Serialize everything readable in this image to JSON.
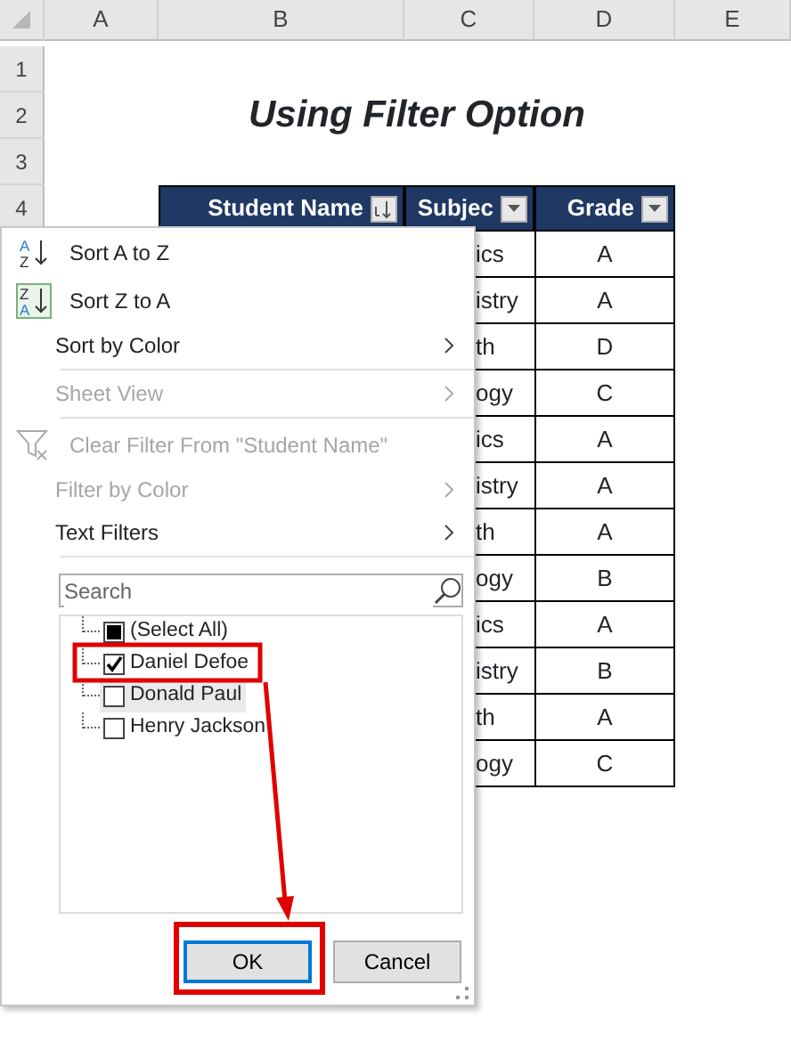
{
  "columns": [
    "A",
    "B",
    "C",
    "D",
    "E"
  ],
  "row_numbers": [
    "1",
    "2",
    "3",
    "4"
  ],
  "title": "Using Filter Option",
  "table": {
    "headers": [
      {
        "label": "Student Name"
      },
      {
        "label": "Subjec"
      },
      {
        "label": "Grade"
      }
    ],
    "rows": [
      {
        "subject": "ics",
        "grade": "A"
      },
      {
        "subject": "istry",
        "grade": "A"
      },
      {
        "subject": "th",
        "grade": "D"
      },
      {
        "subject": "ogy",
        "grade": "C"
      },
      {
        "subject": "ics",
        "grade": "A"
      },
      {
        "subject": "istry",
        "grade": "A"
      },
      {
        "subject": "th",
        "grade": "A"
      },
      {
        "subject": "ogy",
        "grade": "B"
      },
      {
        "subject": "ics",
        "grade": "A"
      },
      {
        "subject": "istry",
        "grade": "B"
      },
      {
        "subject": "th",
        "grade": "A"
      },
      {
        "subject": "ogy",
        "grade": "C"
      }
    ]
  },
  "filter_menu": {
    "items": [
      {
        "kind": "item",
        "label": "Sort A to Z",
        "icon_text": [
          "A",
          "Z"
        ],
        "disabled": false,
        "submenu": false
      },
      {
        "kind": "item",
        "label": "Sort Z to A",
        "icon_text": [
          "Z",
          "A"
        ],
        "disabled": false,
        "submenu": false
      },
      {
        "kind": "item",
        "label": "Sort by Color",
        "disabled": false,
        "submenu": true
      },
      {
        "kind": "separator"
      },
      {
        "kind": "item",
        "label": "Sheet View",
        "disabled": true,
        "submenu": true
      },
      {
        "kind": "separator"
      },
      {
        "kind": "item",
        "label": "Clear Filter From \"Student Name\"",
        "disabled": true,
        "submenu": false
      },
      {
        "kind": "item",
        "label": "Filter by Color",
        "disabled": true,
        "submenu": true
      },
      {
        "kind": "item",
        "label": "Text Filters",
        "disabled": false,
        "submenu": true
      },
      {
        "kind": "separator"
      }
    ],
    "search": {
      "placeholder": "Search"
    },
    "values": [
      {
        "label": "(Select All)",
        "checked": false,
        "indeterminate": true,
        "highlighted": false
      },
      {
        "label": "Daniel Defoe",
        "checked": true,
        "indeterminate": false,
        "highlighted": false
      },
      {
        "label": "Donald Paul",
        "checked": false,
        "indeterminate": false,
        "highlighted": true
      },
      {
        "label": "Henry Jackson",
        "checked": false,
        "indeterminate": false,
        "highlighted": false
      }
    ],
    "buttons": [
      {
        "label": "OK",
        "focused": true
      },
      {
        "label": "Cancel",
        "focused": false
      }
    ]
  }
}
